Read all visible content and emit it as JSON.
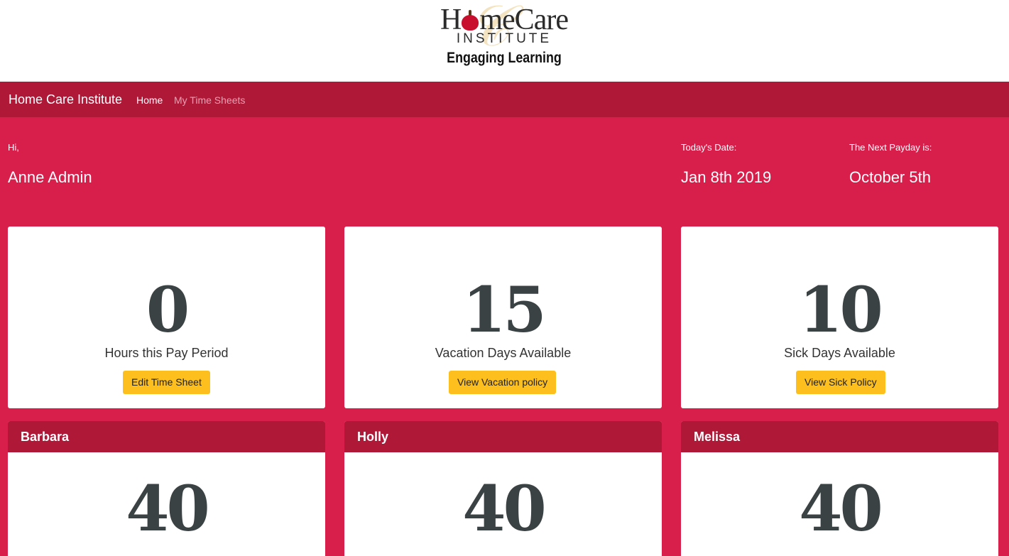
{
  "logo": {
    "main_before": "H",
    "main_after": "meCare",
    "sub": "INSTITUTE",
    "tagline": "Engaging Learning"
  },
  "nav": {
    "brand": "Home Care Institute",
    "items": [
      {
        "label": "Home"
      },
      {
        "label": "My Time Sheets"
      }
    ]
  },
  "greeting": {
    "hi": "Hi,",
    "name": "Anne Admin"
  },
  "today": {
    "label": "Today's Date:",
    "value": "Jan 8th 2019"
  },
  "payday": {
    "label": "The Next Payday is:",
    "value": "October 5th"
  },
  "stats": [
    {
      "value": "0",
      "label": "Hours this Pay Period",
      "button": "Edit Time Sheet"
    },
    {
      "value": "15",
      "label": "Vacation Days Available",
      "button": "View Vacation policy"
    },
    {
      "value": "10",
      "label": "Sick Days Available",
      "button": "View Sick Policy"
    }
  ],
  "employees": [
    {
      "name": "Barbara",
      "value": "40"
    },
    {
      "name": "Holly",
      "value": "40"
    },
    {
      "name": "Melissa",
      "value": "40"
    }
  ],
  "colors": {
    "page_bg": "#d81e4a",
    "navbar_bg": "#b01838",
    "button_bg": "#fdbf1e",
    "number_color": "#3b4243"
  }
}
